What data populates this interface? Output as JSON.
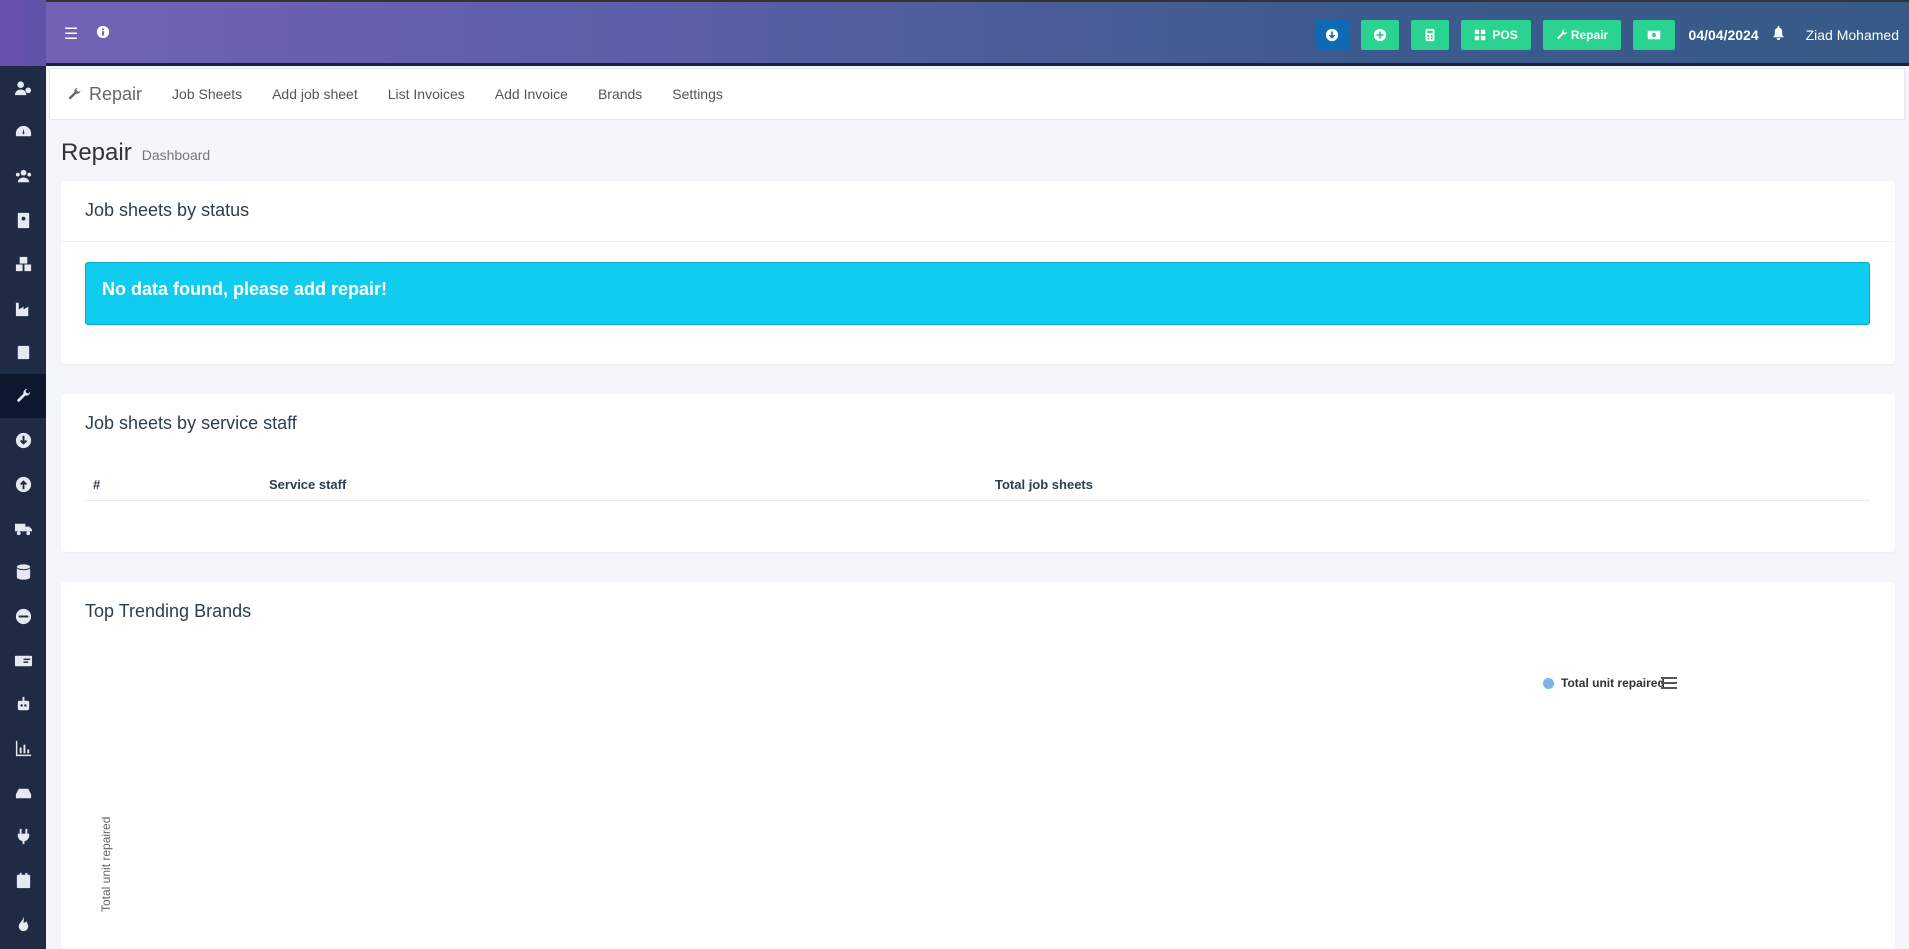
{
  "header": {
    "date": "04/04/2024",
    "user_name": "Ziad Mohamed",
    "buttons": [
      {
        "icon": "download-circle-icon",
        "label": ""
      },
      {
        "icon": "plus-circle-icon",
        "label": ""
      },
      {
        "icon": "calculator-icon",
        "label": ""
      },
      {
        "icon": "grid-icon",
        "label": "POS"
      },
      {
        "icon": "wrench-icon",
        "label": "Repair"
      },
      {
        "icon": "money-icon",
        "label": ""
      }
    ]
  },
  "subnav": {
    "brand": "Repair",
    "links": [
      "Job Sheets",
      "Add job sheet",
      "List Invoices",
      "Add Invoice",
      "Brands",
      "Settings"
    ]
  },
  "page": {
    "title": "Repair",
    "subtitle": "Dashboard"
  },
  "status_box": {
    "title": "Job sheets by status",
    "alert": "No data found, please add repair!"
  },
  "staff_box": {
    "title": "Job sheets by service staff",
    "columns": [
      "#",
      "Service staff",
      "Total job sheets"
    ]
  },
  "brands_box": {
    "title": "Top Trending Brands"
  },
  "chart_data": {
    "type": "bar",
    "title": "",
    "ylabel": "Total unit repaired",
    "series": [
      {
        "name": "Total unit repaired",
        "values": []
      }
    ],
    "categories": [],
    "legend": "top-right"
  },
  "colors": {
    "accent_green": "#2bd391",
    "accent_blue": "#0d6bb6",
    "alert_cyan": "#10ccee",
    "sidebar": "#1f2a44",
    "legend_dot": "#7cb5ec"
  }
}
